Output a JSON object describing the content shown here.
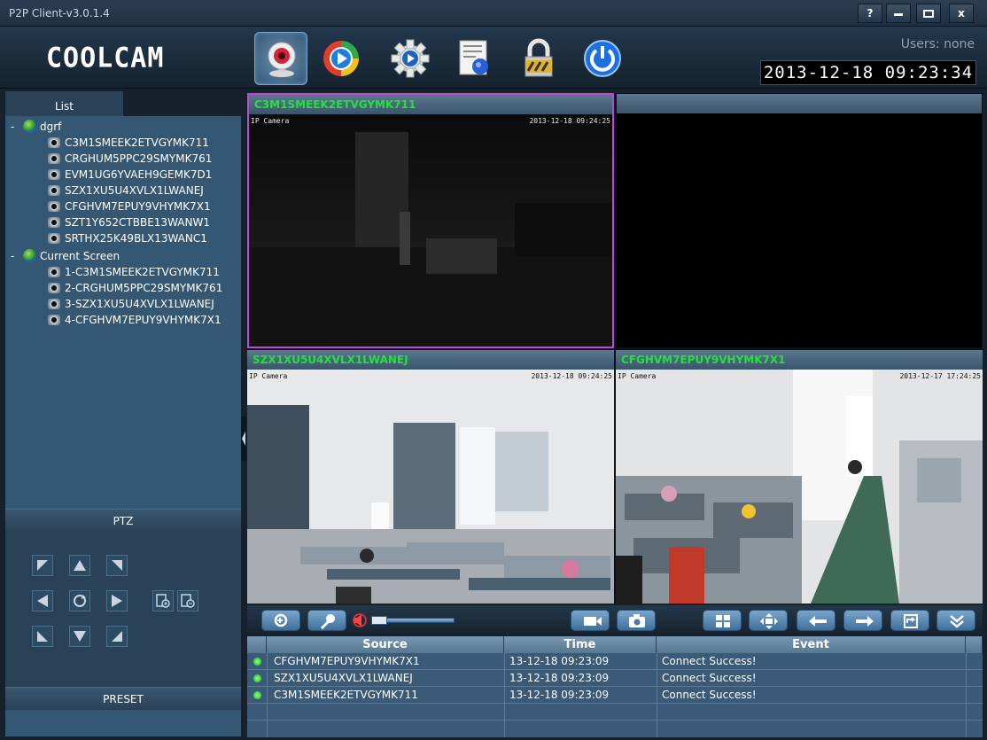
{
  "window": {
    "title": "P2P Client-v3.0.1.4",
    "buttons": [
      "?",
      "‒",
      "☐",
      "x"
    ]
  },
  "header": {
    "logo": "COOLCAM",
    "users": "Users: none",
    "datetime": "2013-12-18  09:23:34",
    "toolbar": [
      "camera-icon",
      "play-icon",
      "settings-gear-icon",
      "log-report-icon",
      "lock-icon",
      "power-icon"
    ]
  },
  "sidebar": {
    "tab": "List",
    "groups": [
      {
        "name": "dgrf",
        "items": [
          "C3M1SMEEK2ETVGYMK711",
          "CRGHUM5PPC29SMYMK761",
          "EVM1UG6YVAEH9GEMK7D1",
          "SZX1XU5U4XVLX1LWANEJ",
          "CFGHVM7EPUY9VHYMK7X1",
          "SZT1Y652CTBBE13WANW1",
          "SRTHX25K49BLX13WANC1"
        ]
      },
      {
        "name": "Current Screen",
        "items": [
          "1-C3M1SMEEK2ETVGYMK711",
          "2-CRGHUM5PPC29SMYMK761",
          "3-SZX1XU5U4XVLX1LWANEJ",
          "4-CFGHVM7EPUY9VHYMK7X1"
        ]
      }
    ],
    "ptz_label": "PTZ",
    "preset_label": "PRESET"
  },
  "video": {
    "panes": [
      {
        "title": "C3M1SMEEK2ETVGYMK711",
        "osd_left": "IP Camera",
        "osd_right": "2013-12-18 09:24:25"
      },
      {
        "title": "",
        "osd_left": "",
        "osd_right": ""
      },
      {
        "title": "SZX1XU5U4XVLX1LWANEJ",
        "osd_left": "IP Camera",
        "osd_right": "2013-12-18 09:24:25"
      },
      {
        "title": "CFGHVM7EPUY9VHYMK7X1",
        "osd_left": "IP Camera",
        "osd_right": "2013-12-17 17:24:25"
      }
    ]
  },
  "log": {
    "headers": {
      "source": "Source",
      "time": "Time",
      "event": "Event"
    },
    "rows": [
      {
        "source": "CFGHVM7EPUY9VHYMK7X1",
        "time": "13-12-18 09:23:09",
        "event": "Connect Success!"
      },
      {
        "source": "SZX1XU5U4XVLX1LWANEJ",
        "time": "13-12-18 09:23:09",
        "event": "Connect Success!"
      },
      {
        "source": "C3M1SMEEK2ETVGYMK711",
        "time": "13-12-18 09:23:09",
        "event": "Connect Success!"
      }
    ]
  },
  "colors": {
    "accent": "#2fe23f",
    "selected_pane_border": "#b94bd4",
    "panel": "#345873"
  }
}
